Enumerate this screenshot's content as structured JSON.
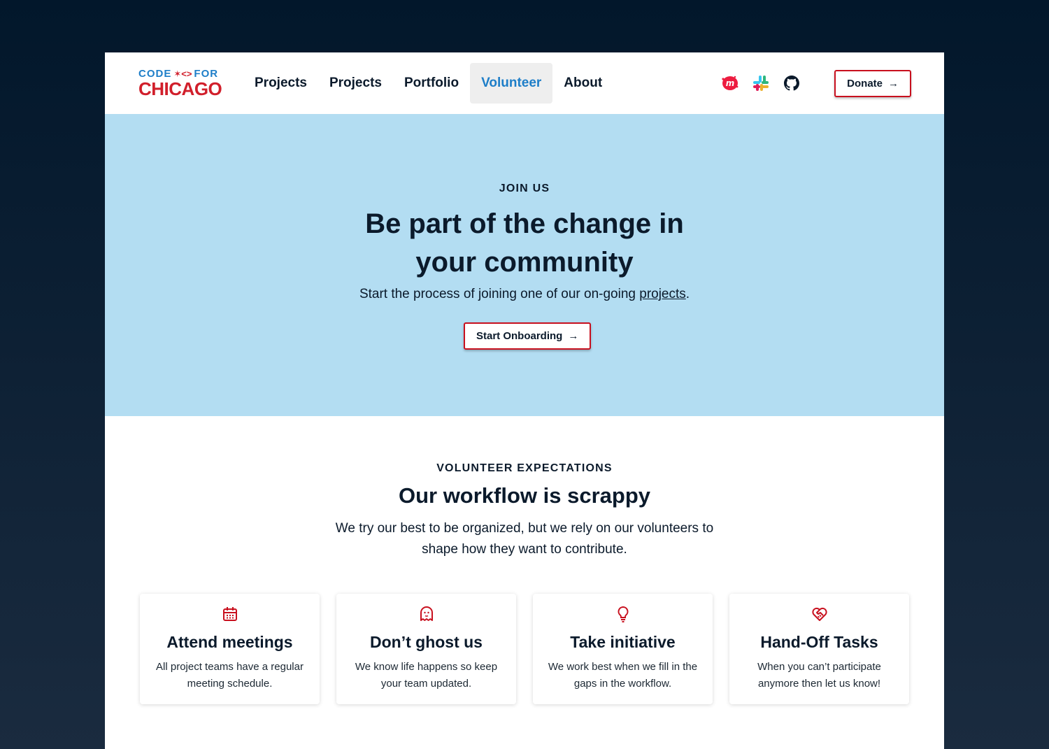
{
  "brand": {
    "logo_top_left": "CODE",
    "logo_top_right": "FOR",
    "logo_bottom": "CHICAGO"
  },
  "nav": {
    "links": [
      "Projects",
      "Projects",
      "Portfolio",
      "Volunteer",
      "About"
    ],
    "active": "Volunteer",
    "donate_label": "Donate"
  },
  "social": {
    "icons": [
      "meetup-icon",
      "slack-icon",
      "github-icon"
    ]
  },
  "hero": {
    "eyebrow": "JOIN US",
    "title_line1": "Be part of the change in",
    "title_line2": "your community",
    "subtitle_before": "Start the process of joining one of our on-going ",
    "subtitle_link": "projects",
    "subtitle_after": ".",
    "cta_label": "Start Onboarding"
  },
  "expectations": {
    "eyebrow": "VOLUNTEER EXPECTATIONS",
    "title": "Our workflow is scrappy",
    "description": "We try our best to be organized, but we rely on our volunteers to shape how they want to contribute.",
    "cards": [
      {
        "icon": "calendar-icon",
        "title": "Attend meetings",
        "text": "All project teams have a regular meeting schedule."
      },
      {
        "icon": "ghost-icon",
        "title": "Don’t ghost us",
        "text": "We know life happens so keep your team updated."
      },
      {
        "icon": "lightbulb-icon",
        "title": "Take initiative",
        "text": "We work best when we fill in the gaps in the workflow."
      },
      {
        "icon": "heart-handshake-icon",
        "title": "Hand-Off Tasks",
        "text": "When you can’t participate anymore then let us know!"
      }
    ]
  },
  "colors": {
    "accent_red": "#c8101e",
    "accent_blue": "#1e7ec8",
    "hero_bg": "#b3ddf2",
    "page_bg": "#02172b"
  }
}
